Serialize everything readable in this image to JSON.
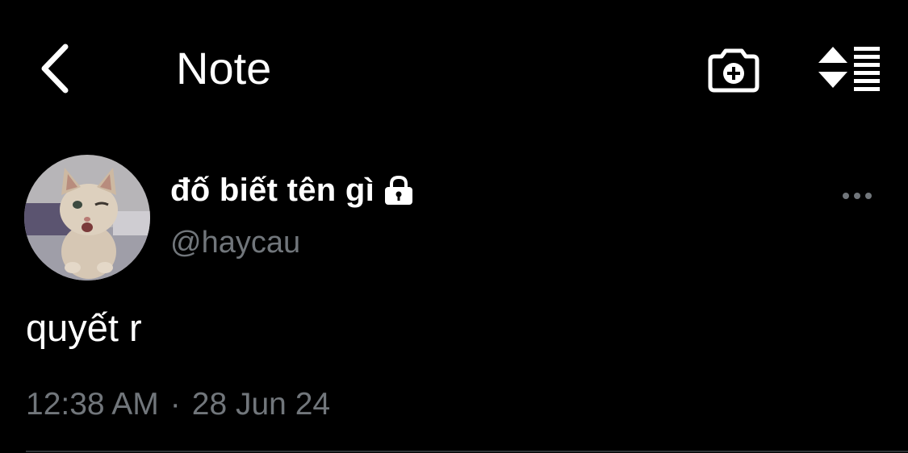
{
  "header": {
    "title": "Note",
    "back_icon": "chevron-left-icon",
    "camera_icon": "camera-add-icon",
    "sort_icon": "sort-list-icon"
  },
  "post": {
    "author": {
      "display_name": "đố biết tên gì",
      "handle": "@haycau",
      "protected_icon": "lock-icon",
      "avatar": "kitten-photo"
    },
    "text": "quyết r",
    "time": "12:38 AM",
    "separator": "·",
    "date": "28 Jun 24",
    "more_icon": "more-horizontal-icon"
  },
  "colors": {
    "background": "#000000",
    "primary_text": "#ffffff",
    "secondary_text": "#71767b",
    "divider": "#2f3336"
  }
}
